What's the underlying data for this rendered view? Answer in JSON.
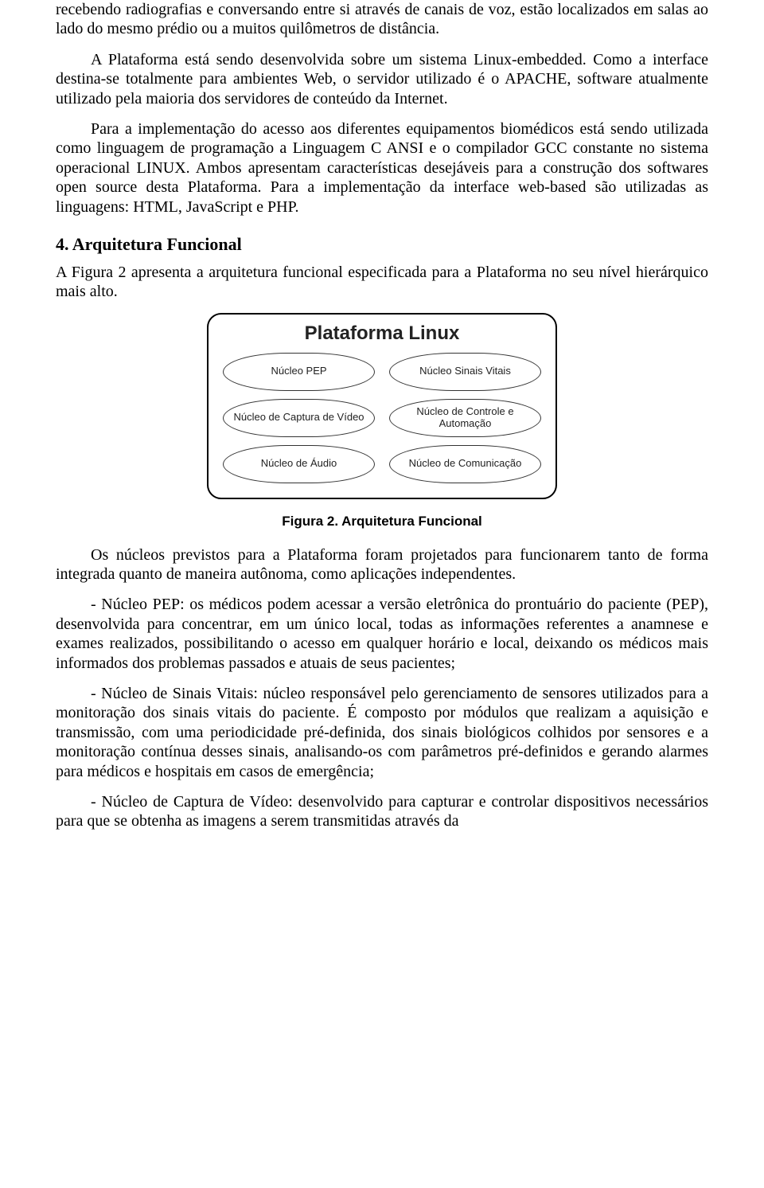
{
  "paragraphs": {
    "p1": "recebendo radiografias e conversando entre si através de canais de voz, estão localizados em salas ao lado do mesmo prédio ou a muitos quilômetros de distância.",
    "p2": "A Plataforma está sendo desenvolvida sobre um sistema Linux-embedded. Como a interface destina-se totalmente para ambientes Web, o servidor utilizado é o APACHE, software atualmente utilizado pela maioria dos servidores de conteúdo da Internet.",
    "p3": "Para a implementação do acesso aos diferentes equipamentos biomédicos está sendo utilizada como linguagem de programação a Linguagem C ANSI e o compilador GCC constante no sistema operacional LINUX. Ambos apresentam características desejáveis para a construção dos softwares open source desta Plataforma. Para a implementação da interface web-based são utilizadas as linguagens: HTML, JavaScript e PHP.",
    "section_heading": "4. Arquitetura Funcional",
    "p4": "A Figura 2 apresenta a arquitetura funcional especificada para a Plataforma no seu nível hierárquico mais alto.",
    "figcaption": "Figura 2. Arquitetura Funcional",
    "p5": "Os núcleos previstos para a Plataforma foram projetados para funcionarem tanto de forma integrada quanto de maneira autônoma, como aplicações independentes.",
    "p6": "- Núcleo PEP: os médicos podem acessar a versão eletrônica do prontuário do paciente (PEP), desenvolvida para concentrar, em um único local, todas as informações referentes a anamnese e exames realizados, possibilitando o acesso em qualquer horário e local, deixando os médicos mais informados dos problemas passados e atuais de seus pacientes;",
    "p7": "- Núcleo de Sinais Vitais: núcleo responsável pelo gerenciamento de sensores utilizados para a monitoração dos sinais vitais do paciente. É composto por módulos que realizam a aquisição e transmissão, com uma periodicidade pré-definida, dos sinais biológicos colhidos por sensores e a monitoração contínua desses sinais, analisando-os com parâmetros pré-definidos e gerando alarmes para médicos e hospitais em casos de emergência;",
    "p8": "- Núcleo de Captura de Vídeo: desenvolvido para capturar e controlar dispositivos necessários para que se obtenha as imagens a serem transmitidas através da"
  },
  "figure": {
    "title": "Plataforma Linux",
    "nodes": {
      "n1": "Núcleo PEP",
      "n2": "Núcleo Sinais Vitais",
      "n3": "Núcleo de Captura de Vídeo",
      "n4": "Núcleo de Controle e Automação",
      "n5": "Núcleo de Áudio",
      "n6": "Núcleo de Comunicação"
    }
  }
}
